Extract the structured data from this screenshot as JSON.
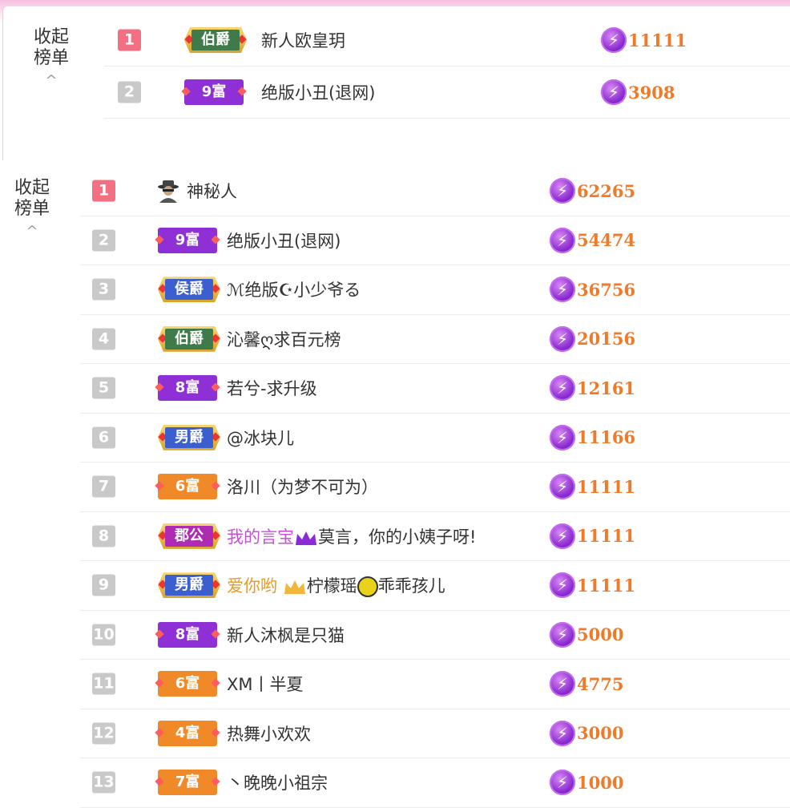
{
  "top_section": {
    "collapse_line1": "收起",
    "collapse_line2": "榜单",
    "chevron": "^",
    "rows": [
      {
        "rank": "1",
        "badge": "伯爵",
        "badge_kind": "noble-green",
        "name": "新人欧皇玥",
        "score": "11111"
      },
      {
        "rank": "2",
        "badge": "9富",
        "badge_kind": "rich-purple",
        "name": "绝版小丑(退网)",
        "score": "3908"
      }
    ]
  },
  "main_section": {
    "collapse_line1": "收起",
    "collapse_line2": "榜单",
    "chevron": "^",
    "rows": [
      {
        "rank": "1",
        "badge": "",
        "badge_kind": "mystery",
        "name": "神秘人",
        "score": "62265"
      },
      {
        "rank": "2",
        "badge": "9富",
        "badge_kind": "rich-purple",
        "name": "绝版小丑(退网)",
        "score": "54474"
      },
      {
        "rank": "3",
        "badge": "侯爵",
        "badge_kind": "noble-blue",
        "name": "ℳ绝版☪小少爷る",
        "score": "36756"
      },
      {
        "rank": "4",
        "badge": "伯爵",
        "badge_kind": "noble-green",
        "name": "沁馨ღ求百元榜",
        "score": "20156"
      },
      {
        "rank": "5",
        "badge": "8富",
        "badge_kind": "rich-purple",
        "name": "若兮-求升级",
        "score": "12161"
      },
      {
        "rank": "6",
        "badge": "男爵",
        "badge_kind": "noble-blue",
        "name": "@冰块儿",
        "score": "11166"
      },
      {
        "rank": "7",
        "badge": "6富",
        "badge_kind": "rich-orange",
        "name": "洛川（为梦不可为）",
        "score": "11111"
      },
      {
        "rank": "8",
        "badge": "郡公",
        "badge_kind": "noble-magenta",
        "name_parts": [
          "我的言宝",
          "莫言，你的小姨子呀!"
        ],
        "score": "11111"
      },
      {
        "rank": "9",
        "badge": "男爵",
        "badge_kind": "noble-blue",
        "name_parts": [
          "爱你哟",
          "柠檬瑶",
          "乖乖孩儿"
        ],
        "score": "11111"
      },
      {
        "rank": "10",
        "badge": "8富",
        "badge_kind": "rich-purple",
        "name": "新人沐枫是只猫",
        "score": "5000"
      },
      {
        "rank": "11",
        "badge": "6富",
        "badge_kind": "rich-orange",
        "name": "XM丨半夏",
        "score": "4775"
      },
      {
        "rank": "12",
        "badge": "4富",
        "badge_kind": "rich-orange",
        "name": "热舞小欢欢",
        "score": "3000"
      },
      {
        "rank": "13",
        "badge": "7富",
        "badge_kind": "rich-orange",
        "name": "丶晚晚小祖宗",
        "score": "1000"
      }
    ]
  },
  "colors": {
    "rank_first": "#f36f82",
    "rank_other": "#c9c9c9",
    "score": "#ee7a2a",
    "gem": "#8a2bd0",
    "rich_purple": "#8f2fd6",
    "rich_orange": "#f08a28",
    "noble_green": "#3f7a4a",
    "noble_blue": "#3c5fd0",
    "noble_magenta": "#b02bb3",
    "highlight_pink": "#c84fdc",
    "highlight_orange": "#e69a2a"
  },
  "icons": {
    "gem": "lightning-gem-icon",
    "mystery": "mystery-person-icon",
    "crown_purple": "purple-crown-icon",
    "crown_gold": "gold-crown-icon",
    "lemon": "lemon-icon"
  }
}
